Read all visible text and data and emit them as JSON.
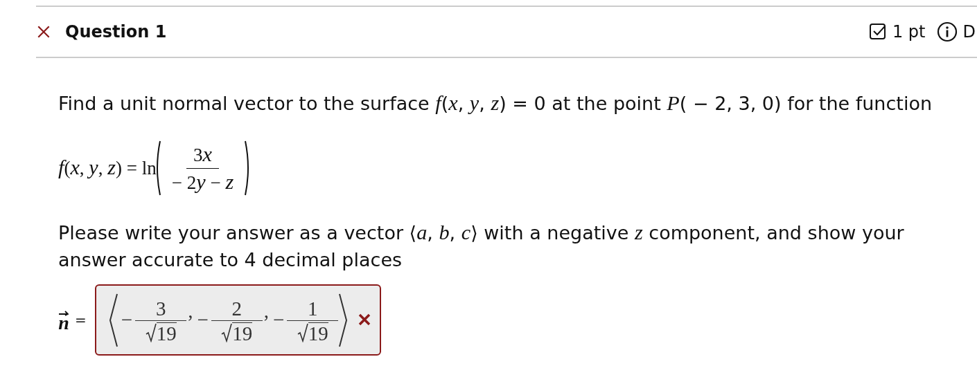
{
  "header": {
    "correct": false,
    "title": "Question 1",
    "points": "1 pt",
    "details": "D"
  },
  "prompt": "Find a unit normal vector to the surface *f*(*x*, *y*, *z*) = 0 at the point *P*( − 2, 3, 0) for the function",
  "formula": {
    "lhs": "*f*(*x*, *y*, *z*) = ln",
    "numerator": [
      {
        "kind": "number",
        "text": "3"
      },
      {
        "kind": "variable",
        "text": "x"
      }
    ],
    "denominator": [
      {
        "kind": "number",
        "text": "− 2"
      },
      {
        "kind": "variable",
        "text": "y"
      },
      {
        "kind": "number",
        "text": " − "
      },
      {
        "kind": "variable",
        "text": "z"
      }
    ]
  },
  "instructions": "Please write your answer as a vector ⟨*a*, *b*, *c*⟩ with a negative *z* component, and show your answer accurate to 4 decimal places",
  "answer": {
    "variable": "n",
    "equals": "=",
    "correct": false,
    "components": [
      {
        "sign": "−",
        "numerator": "3",
        "radicand": "19",
        "separator": ","
      },
      {
        "sign": "−",
        "numerator": "2",
        "radicand": "19",
        "separator": ","
      },
      {
        "sign": "−",
        "numerator": "1",
        "radicand": "19"
      }
    ]
  }
}
